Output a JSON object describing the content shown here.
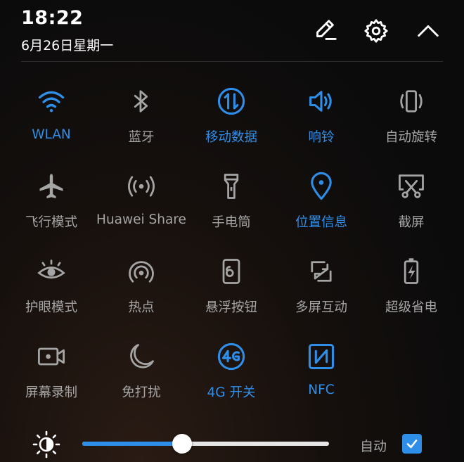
{
  "colors": {
    "accent": "#2f8ee8",
    "inactive": "#a5a5a5"
  },
  "status": {
    "time": "18:22",
    "date": "6月26日星期一"
  },
  "header": {
    "edit_icon": "pencil-icon",
    "settings_icon": "gear-icon",
    "collapse_icon": "chevron-up-icon"
  },
  "tiles": [
    {
      "label": "WLAN",
      "icon": "wifi-icon",
      "active": true
    },
    {
      "label": "蓝牙",
      "icon": "bluetooth-icon",
      "active": false
    },
    {
      "label": "移动数据",
      "icon": "mobile-data-icon",
      "active": true
    },
    {
      "label": "响铃",
      "icon": "speaker-icon",
      "active": true
    },
    {
      "label": "自动旋转",
      "icon": "rotate-icon",
      "active": false
    },
    {
      "label": "飞行模式",
      "icon": "airplane-icon",
      "active": false
    },
    {
      "label": "Huawei Share",
      "icon": "share-broadcast-icon",
      "active": false
    },
    {
      "label": "手电筒",
      "icon": "flashlight-icon",
      "active": false
    },
    {
      "label": "位置信息",
      "icon": "location-pin-icon",
      "active": true
    },
    {
      "label": "截屏",
      "icon": "screenshot-scissors-icon",
      "active": false
    },
    {
      "label": "护眼模式",
      "icon": "eye-icon",
      "active": false
    },
    {
      "label": "热点",
      "icon": "hotspot-icon",
      "active": false
    },
    {
      "label": "悬浮按钮",
      "icon": "floating-button-icon",
      "active": false
    },
    {
      "label": "多屏互动",
      "icon": "multi-screen-icon",
      "active": false
    },
    {
      "label": "超级省电",
      "icon": "battery-saver-icon",
      "active": false
    },
    {
      "label": "屏幕录制",
      "icon": "screen-record-icon",
      "active": false
    },
    {
      "label": "免打扰",
      "icon": "moon-icon",
      "active": false
    },
    {
      "label": "4G 开关",
      "icon": "4g-icon",
      "active": true
    },
    {
      "label": "NFC",
      "icon": "nfc-icon",
      "active": true
    }
  ],
  "brightness": {
    "level": 0.405,
    "auto_label": "自动",
    "auto_checked": true
  }
}
